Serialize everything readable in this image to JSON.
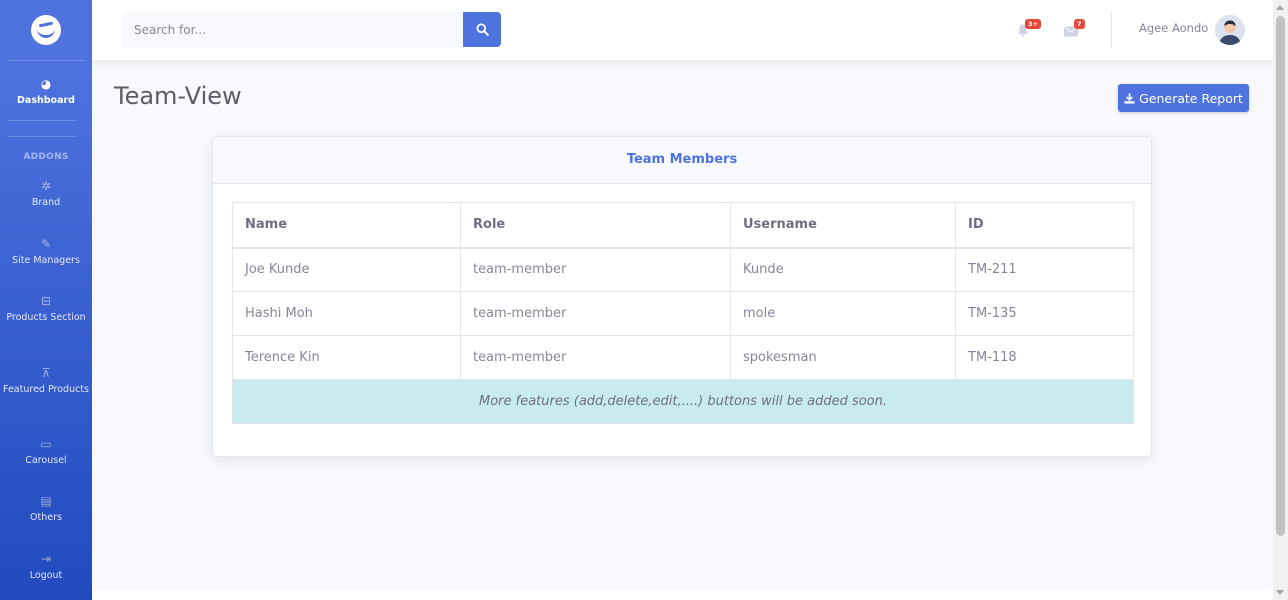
{
  "sidebar": {
    "brand_icon": "smile-logo-icon",
    "items": [
      {
        "label": "Dashboard",
        "icon": "dashboard-icon",
        "glyph": "◕",
        "active": true
      },
      {
        "label": "Brand",
        "icon": "gear-icon",
        "glyph": "✲"
      },
      {
        "label": "Site Managers",
        "icon": "edit-icon",
        "glyph": "✎"
      },
      {
        "label": "Products Section",
        "icon": "briefcase-icon",
        "glyph": "⊟"
      },
      {
        "label": "Featured Products",
        "icon": "thumbtack-icon",
        "glyph": "⊼"
      },
      {
        "label": "Carousel",
        "icon": "desktop-icon",
        "glyph": "▭"
      },
      {
        "label": "Others",
        "icon": "clipboard-icon",
        "glyph": "▤"
      },
      {
        "label": "Logout",
        "icon": "sign-out-icon",
        "glyph": "⇥"
      }
    ],
    "heading": "ADDONS"
  },
  "topbar": {
    "search_placeholder": "Search for...",
    "alerts_badge": "3+",
    "messages_badge": "7",
    "user_name": "Agee Aondo"
  },
  "page": {
    "title": "Team-View",
    "report_button": "Generate Report"
  },
  "card": {
    "title": "Team Members",
    "columns": [
      "Name",
      "Role",
      "Username",
      "ID"
    ],
    "rows": [
      [
        "Joe Kunde",
        "team-member",
        "Kunde",
        "TM-211"
      ],
      [
        "Hashi Moh",
        "team-member",
        "mole",
        "TM-135"
      ],
      [
        "Terence Kin",
        "team-member",
        "spokesman",
        "TM-118"
      ]
    ],
    "note": "More features (add,delete,edit,....) buttons will be added soon."
  },
  "colors": {
    "primary": "#4e73df",
    "badge": "#e74a3b",
    "note_bg": "#c8ebf0"
  }
}
